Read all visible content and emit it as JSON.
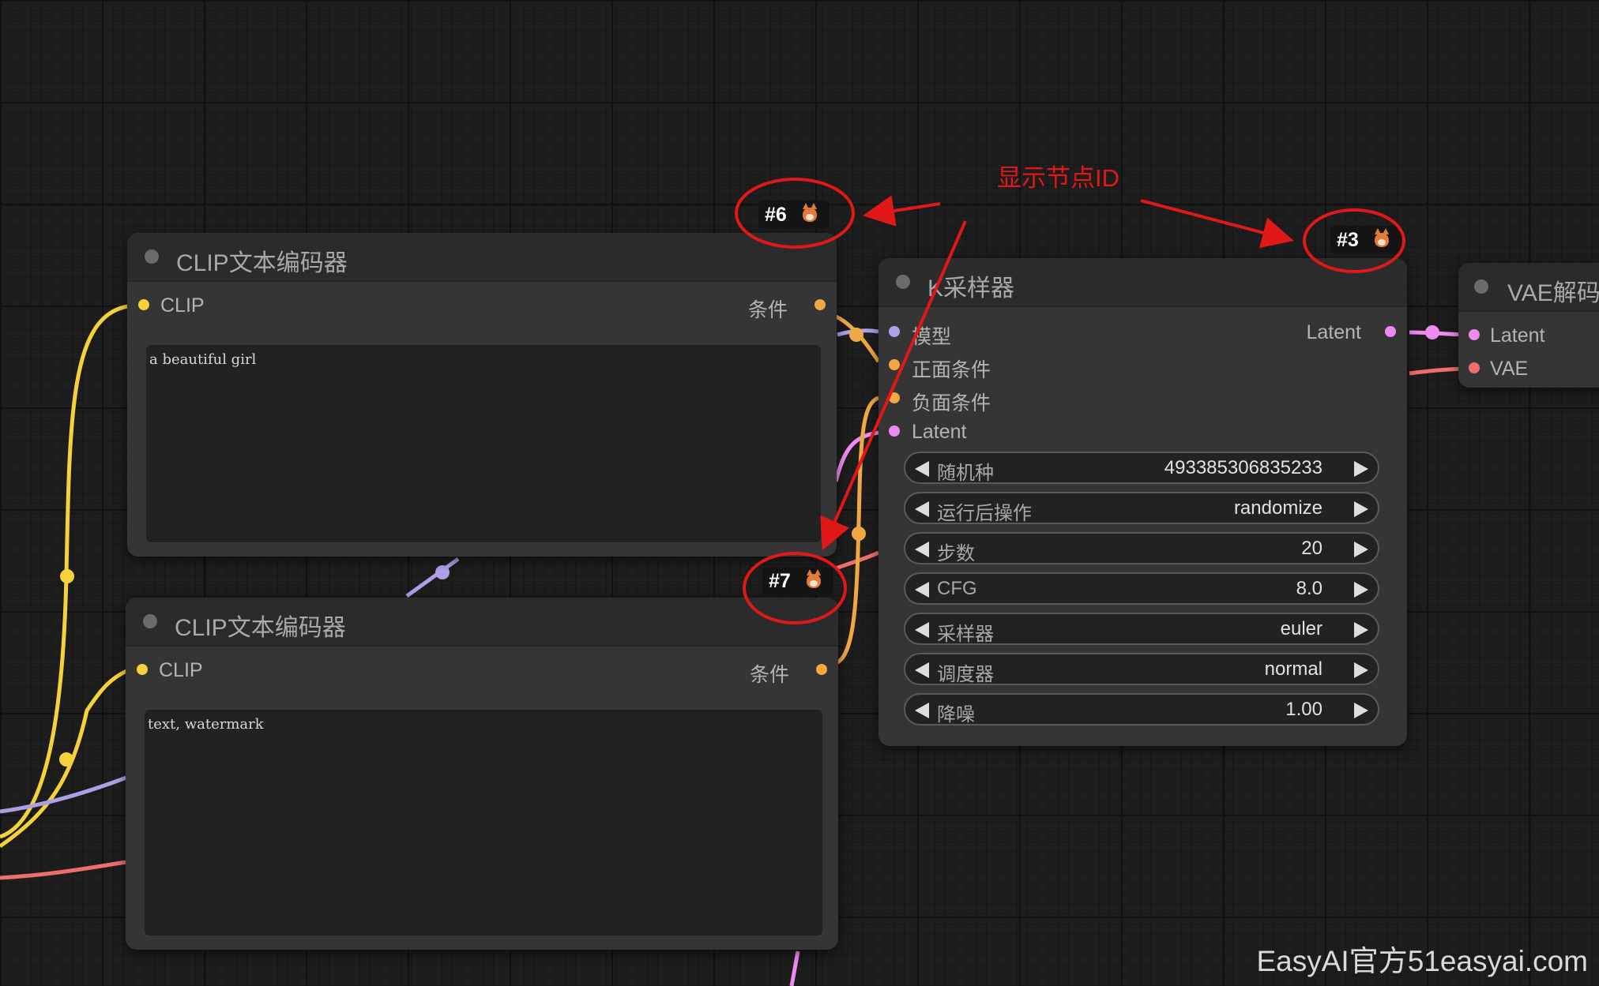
{
  "annotation": {
    "text": "显示节点ID",
    "color": "#e01818"
  },
  "watermark": "EasyAI官方51easyai.com",
  "colors": {
    "clip": "#f5d13a",
    "conditioning": "#f0a845",
    "model": "#b09ee6",
    "latent": "#ee8af0",
    "vae": "#ee6e6e"
  },
  "nodes": {
    "clip_pos": {
      "id_badge": "#6",
      "title": "CLIP文本编码器",
      "input": "CLIP",
      "output": "条件",
      "text": "a beautiful girl"
    },
    "clip_neg": {
      "id_badge": "#7",
      "title": "CLIP文本编码器",
      "input": "CLIP",
      "output": "条件",
      "text": "text, watermark"
    },
    "ksampler": {
      "id_badge": "#3",
      "title": "K采样器",
      "inputs": [
        "模型",
        "正面条件",
        "负面条件",
        "Latent"
      ],
      "output": "Latent",
      "widgets": [
        {
          "label": "随机种",
          "value": "493385306835233"
        },
        {
          "label": "运行后操作",
          "value": "randomize"
        },
        {
          "label": "步数",
          "value": "20"
        },
        {
          "label": "CFG",
          "value": "8.0"
        },
        {
          "label": "采样器",
          "value": "euler"
        },
        {
          "label": "调度器",
          "value": "normal"
        },
        {
          "label": "降噪",
          "value": "1.00"
        }
      ]
    },
    "vae_decode": {
      "title": "VAE解码",
      "inputs": [
        "Latent",
        "VAE"
      ]
    }
  }
}
